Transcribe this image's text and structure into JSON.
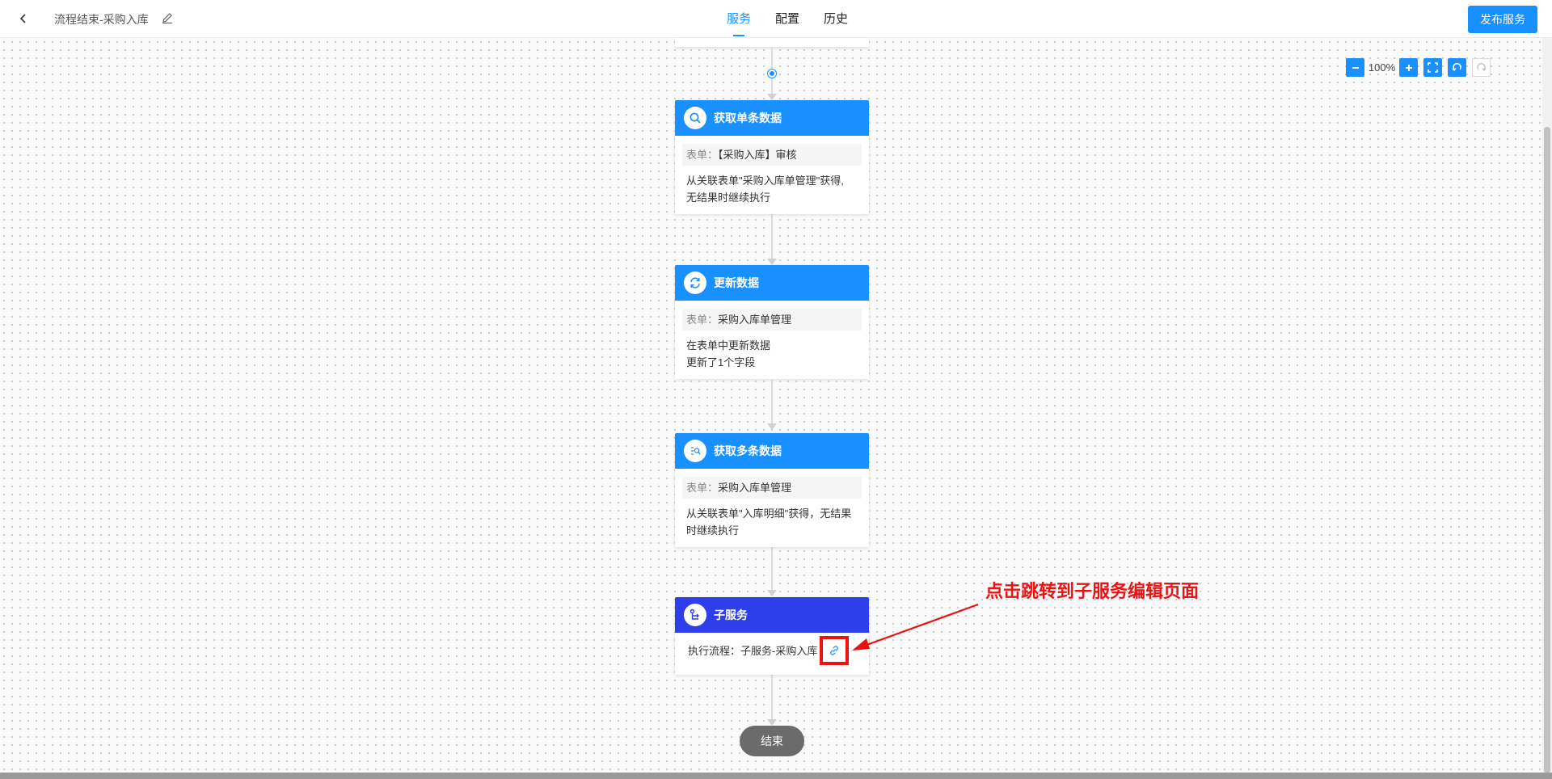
{
  "header": {
    "title": "流程结束-采购入库",
    "tabs": [
      {
        "label": "服务",
        "active": true
      },
      {
        "label": "配置",
        "active": false
      },
      {
        "label": "历史",
        "active": false
      }
    ],
    "publish_label": "发布服务"
  },
  "zoom": {
    "level": "100%"
  },
  "nodes": [
    {
      "title": "获取单条数据",
      "icon": "search-icon",
      "form_label": "表单：",
      "form_value": "【采购入库】审核",
      "desc_lines": [
        "从关联表单\"采购入库单管理\"获得,",
        "无结果时继续执行"
      ]
    },
    {
      "title": "更新数据",
      "icon": "refresh-icon",
      "form_label": "表单：",
      "form_value": "采购入库单管理",
      "desc_lines": [
        "在表单中更新数据",
        "更新了1个字段"
      ]
    },
    {
      "title": "获取多条数据",
      "icon": "multi-data-icon",
      "form_label": "表单：",
      "form_value": "采购入库单管理",
      "desc_lines": [
        "从关联表单\"入库明细\"获得，无结果",
        "时继续执行"
      ]
    },
    {
      "title": "子服务",
      "icon": "subservice-icon",
      "exec_text": "执行流程：子服务-采购入库"
    }
  ],
  "end_label": "结束",
  "annotation": {
    "text": "点击跳转到子服务编辑页面"
  },
  "colors": {
    "primary": "#1890ff",
    "subservice": "#2d3eea",
    "annotation": "#e81414"
  }
}
